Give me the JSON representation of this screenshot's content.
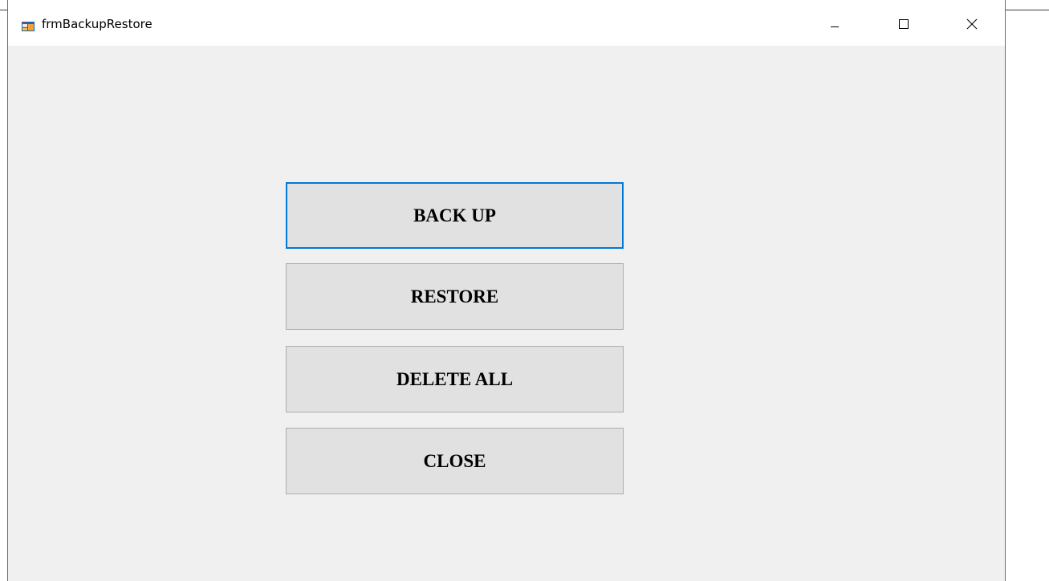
{
  "window": {
    "title": "frmBackupRestore",
    "icon": "form-icon",
    "controls": {
      "minimize_icon": "minimize-icon",
      "maximize_icon": "maximize-icon",
      "close_icon": "close-icon"
    },
    "accent_color": "#0078d7"
  },
  "buttons": {
    "backup_label": "BACK UP",
    "restore_label": "RESTORE",
    "delete_all_label": "DELETE ALL",
    "close_label": "CLOSE"
  }
}
